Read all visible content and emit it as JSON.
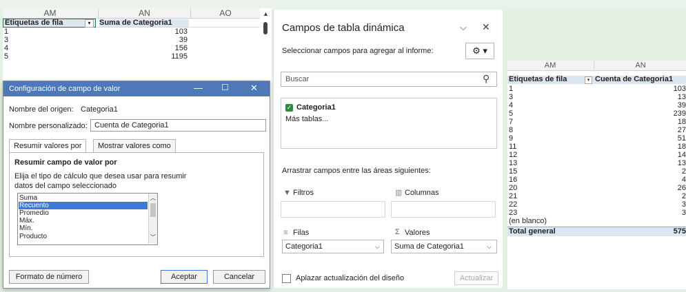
{
  "left_sheet": {
    "columns": [
      "AM",
      "AN",
      "AO"
    ],
    "header_labels": [
      "Etiquetas de fila",
      "Suma de Categoria1"
    ],
    "rows": [
      [
        "1",
        "103"
      ],
      [
        "3",
        "39"
      ],
      [
        "4",
        "156"
      ],
      [
        "5",
        "1195"
      ]
    ]
  },
  "dialog": {
    "title": "Configuración de campo de valor",
    "source_label": "Nombre del origen:",
    "source_value": "Categoria1",
    "custom_label": "Nombre personalizado:",
    "custom_value": "Cuenta de Categoria1",
    "tabs": [
      "Resumir valores por",
      "Mostrar valores como"
    ],
    "section_title": "Resumir campo de valor por",
    "instruction_line1": "Elija el tipo de cálculo que desea usar para resumir",
    "instruction_line2": "datos del campo seleccionado",
    "list_items": [
      "Suma",
      "Recuento",
      "Promedio",
      "Máx.",
      "Mín.",
      "Producto"
    ],
    "selected_item": "Recuento",
    "number_format_button": "Formato de número",
    "ok_button": "Aceptar",
    "cancel_button": "Cancelar"
  },
  "pivot_pane": {
    "title": "Campos de tabla dinámica",
    "subtitle": "Seleccionar campos para agregar al informe:",
    "search_placeholder": "Buscar",
    "fields": [
      "Categoria1"
    ],
    "more_tables": "Más tablas...",
    "drag_instruction": "Arrastrar campos entre las áreas siguientes:",
    "areas": {
      "filters": "Filtros",
      "columns": "Columnas",
      "rows": "Filas",
      "values": "Valores",
      "rows_value": "Categoria1",
      "values_value": "Suma de Categoria1"
    },
    "defer_label": "Aplazar actualización del diseño",
    "update_button": "Actualizar"
  },
  "right_sheet": {
    "columns": [
      "AM",
      "AN"
    ],
    "header_labels": [
      "Etiquetas de fila",
      "Cuenta de Categoria1"
    ],
    "rows": [
      [
        "1",
        "103"
      ],
      [
        "3",
        "13"
      ],
      [
        "4",
        "39"
      ],
      [
        "5",
        "239"
      ],
      [
        "7",
        "18"
      ],
      [
        "8",
        "27"
      ],
      [
        "9",
        "51"
      ],
      [
        "11",
        "18"
      ],
      [
        "12",
        "14"
      ],
      [
        "13",
        "13"
      ],
      [
        "15",
        "2"
      ],
      [
        "16",
        "4"
      ],
      [
        "20",
        "26"
      ],
      [
        "21",
        "2"
      ],
      [
        "22",
        "3"
      ],
      [
        "23",
        "3"
      ],
      [
        "(en blanco)",
        ""
      ]
    ],
    "total_label": "Total general",
    "total_value": "575"
  },
  "colors": {
    "excel_green": "#217346",
    "title_blue": "#4e78b8",
    "selection_blue": "#3c78d8",
    "header_blue": "#dce6f1"
  }
}
